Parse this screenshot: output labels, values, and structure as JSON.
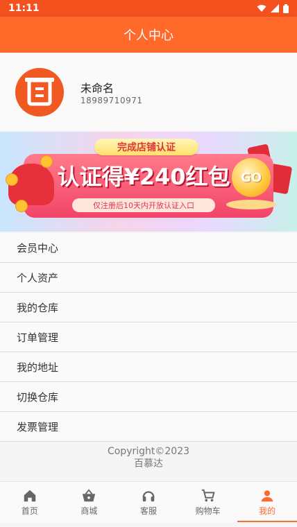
{
  "status_bar": {
    "time": "11:11"
  },
  "header": {
    "title": "个人中心"
  },
  "profile": {
    "name": "未命名",
    "phone": "18989710971"
  },
  "banner": {
    "top_label": "完成店铺认证",
    "headline": "认证得¥240红包",
    "subline": "仅注册后10天内开放认证入口",
    "go_label": "GO"
  },
  "menu": {
    "items": [
      {
        "label": "会员中心"
      },
      {
        "label": "个人资产"
      },
      {
        "label": "我的仓库"
      },
      {
        "label": "订单管理"
      },
      {
        "label": "我的地址"
      },
      {
        "label": "切换仓库"
      },
      {
        "label": "发票管理"
      }
    ]
  },
  "footer": {
    "copyright": "Copyright©2023",
    "company": "百慕达"
  },
  "tabbar": {
    "tabs": [
      {
        "label": "首页",
        "icon": "home-icon"
      },
      {
        "label": "商城",
        "icon": "basket-icon"
      },
      {
        "label": "客服",
        "icon": "headset-icon"
      },
      {
        "label": "购物车",
        "icon": "cart-icon"
      },
      {
        "label": "我的",
        "icon": "person-icon",
        "active": true
      }
    ]
  },
  "colors": {
    "accent": "#ff6a2b",
    "status_bar": "#f4511e"
  }
}
